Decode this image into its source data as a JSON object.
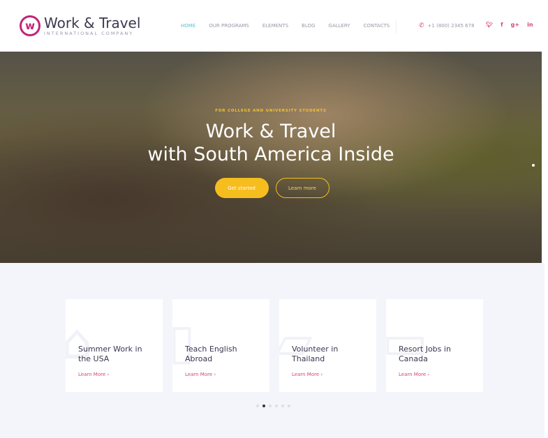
{
  "header": {
    "logo_title": "Work & Travel",
    "logo_sub": "INTERNATIONAL COMPANY",
    "nav": [
      {
        "label": "HOME",
        "active": true
      },
      {
        "label": "OUR PROGRAMS"
      },
      {
        "label": "ELEMENTS"
      },
      {
        "label": "BLOG"
      },
      {
        "label": "GALLERY"
      },
      {
        "label": "CONTACTS"
      }
    ],
    "phone": "+1 (800) 2345 678",
    "social": [
      "twitter-icon",
      "facebook-icon",
      "google-plus-icon",
      "linkedin-icon"
    ]
  },
  "hero": {
    "eyebrow": "FOR COLLEGE AND UNIVERSITY STUDENTS",
    "title_line1": "Work & Travel",
    "title_line2": "with South America Inside",
    "primary": "Get started",
    "secondary": "Learn more"
  },
  "programs": [
    {
      "title": "Summer Work in the USA",
      "link": "Learn More"
    },
    {
      "title": "Teach English Abroad",
      "link": "Learn More"
    },
    {
      "title": "Volunteer in Thailand",
      "link": "Learn More"
    },
    {
      "title": "Resort Jobs in Canada",
      "link": "Learn More"
    }
  ],
  "pagination": {
    "total": 6,
    "active": 2
  },
  "colors": {
    "accent": "#d6457d",
    "yellow": "#f6bd1e",
    "nav_active": "#4fc3d9"
  }
}
